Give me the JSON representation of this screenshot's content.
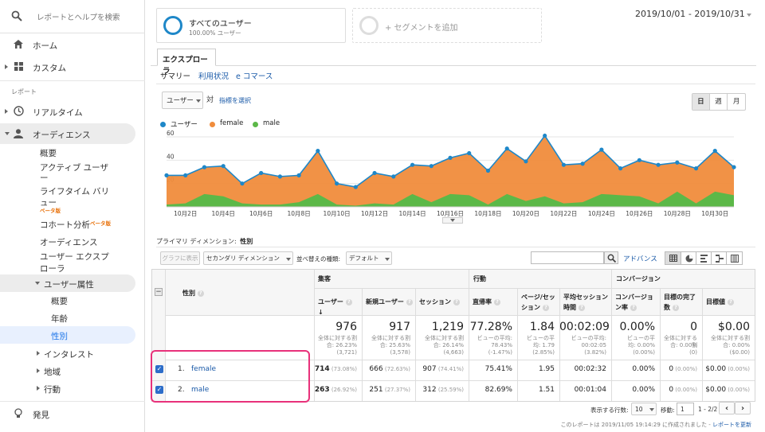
{
  "sidebar": {
    "search_placeholder": "レポートとヘルプを検索",
    "home": "ホーム",
    "custom": "カスタム",
    "reports_header": "レポート",
    "realtime": "リアルタイム",
    "audience": "オーディエンス",
    "overview": "概要",
    "active_users_1": "アクティブ ユーザ",
    "active_users_2": "ー",
    "lifetime_1": "ライフタイム バリ",
    "lifetime_2": "ュー",
    "beta": "ベータ版",
    "cohort": "コホート分析",
    "audiences": "オーディエンス",
    "user_explorer_1": "ユーザー エクスプ",
    "user_explorer_2": "ローラ",
    "demographics": "ユーザー属性",
    "demo_overview": "概要",
    "age": "年齢",
    "gender": "性別",
    "interests": "インタレスト",
    "geo": "地域",
    "behavior": "行動",
    "discover": "発見"
  },
  "segment": {
    "name": "すべてのユーザー",
    "pct": "100.00% ユーザー",
    "add": "+ セグメントを追加"
  },
  "date_range": "2019/10/01 - 2019/10/31",
  "tab_explorer": "エクスプローラ",
  "subtabs": [
    "サマリー",
    "利用状況",
    "e コマース"
  ],
  "metric_select": "ユーザー",
  "vs": "対",
  "select_metric": "指標を選択",
  "granularity": [
    "日",
    "週",
    "月"
  ],
  "legend": [
    {
      "name": "ユーザー",
      "color": "#1e87c8"
    },
    {
      "name": "female",
      "color": "#f08c3c"
    },
    {
      "name": "male",
      "color": "#5cb848"
    }
  ],
  "chart_data": {
    "type": "area",
    "x": [
      "10/1",
      "10/2",
      "10/3",
      "10/4",
      "10/5",
      "10/6",
      "10/7",
      "10/8",
      "10/9",
      "10/10",
      "10/11",
      "10/12",
      "10/13",
      "10/14",
      "10/15",
      "10/16",
      "10/17",
      "10/18",
      "10/19",
      "10/20",
      "10/21",
      "10/22",
      "10/23",
      "10/24",
      "10/25",
      "10/26",
      "10/27",
      "10/28",
      "10/29",
      "10/30",
      "10/31"
    ],
    "x_tick_labels": [
      "10月2日",
      "10月4日",
      "10月6日",
      "10月8日",
      "10月10日",
      "10月12日",
      "10月14日",
      "10月16日",
      "10月18日",
      "10月20日",
      "10月22日",
      "10月24日",
      "10月26日",
      "10月28日",
      "10月30日"
    ],
    "y_ticks": [
      "60",
      "40",
      "20"
    ],
    "ylim": [
      0,
      60
    ],
    "series": [
      {
        "name": "ユーザー",
        "values": [
          27,
          27,
          34,
          35,
          20,
          29,
          26,
          27,
          48,
          20,
          17,
          29,
          26,
          36,
          35,
          42,
          46,
          31,
          50,
          39,
          61,
          36,
          37,
          49,
          33,
          40,
          36,
          38,
          33,
          48,
          34
        ]
      },
      {
        "name": "female",
        "values": [
          27,
          27,
          34,
          35,
          20,
          29,
          26,
          27,
          48,
          20,
          17,
          29,
          26,
          36,
          35,
          42,
          46,
          31,
          50,
          39,
          61,
          36,
          37,
          49,
          33,
          40,
          36,
          38,
          33,
          48,
          34
        ]
      },
      {
        "name": "male",
        "values": [
          2,
          3,
          11,
          9,
          3,
          2,
          2,
          4,
          11,
          2,
          1,
          3,
          2,
          11,
          4,
          11,
          10,
          2,
          11,
          5,
          9,
          3,
          4,
          11,
          10,
          9,
          3,
          13,
          3,
          13,
          10
        ]
      }
    ]
  },
  "primary_dimension_label": "プライマリ ディメンション:",
  "primary_dimension_value": "性別",
  "toolbar": {
    "plot": "グラフに表示",
    "secondary": "セカンダリ ディメンション",
    "sort_label": "並べ替えの種類:",
    "sort_value": "デフォルト",
    "advanced": "アドバンス"
  },
  "table": {
    "dim_header": "性別",
    "groups": [
      "集客",
      "行動",
      "コンバージョン"
    ],
    "headers": [
      [
        "ユーザー"
      ],
      [
        "新規ユーザー"
      ],
      [
        "セッション"
      ],
      [
        "直帰率"
      ],
      [
        "ページ/セッ",
        "ション"
      ],
      [
        "平均セッション",
        "時間"
      ],
      [
        "コンバージョ",
        "ン率"
      ],
      [
        "目標の完了",
        "数"
      ],
      [
        "目標値"
      ]
    ],
    "totals": [
      {
        "big": "976",
        "small": [
          "全体に対する割",
          "合: 26.23%",
          "(3,721)"
        ]
      },
      {
        "big": "917",
        "small": [
          "全体に対する割",
          "合: 25.63%",
          "(3,578)"
        ]
      },
      {
        "big": "1,219",
        "small": [
          "全体に対する割",
          "合: 26.14%",
          "(4,663)"
        ]
      },
      {
        "big": "77.28%",
        "small": [
          "ビューの平均:",
          "78.43%",
          "(-1.47%)"
        ]
      },
      {
        "big": "1.84",
        "small": [
          "ビューの平",
          "均: 1.79",
          "(2.85%)"
        ]
      },
      {
        "big": "00:02:09",
        "small": [
          "ビューの平均:",
          "00:02:05",
          "(3.82%)"
        ]
      },
      {
        "big": "0.00%",
        "small": [
          "ビューの平",
          "均: 0.00%",
          "(0.00%)"
        ]
      },
      {
        "big": "0",
        "small": [
          "全体に対する割",
          "合: 0.00%",
          "(0)"
        ]
      },
      {
        "big": "$0.00",
        "small": [
          "全体に対する割",
          "合: 0.00%",
          "($0.00)"
        ]
      }
    ],
    "rows": [
      {
        "idx": "1.",
        "name": "female",
        "cells": [
          [
            "714",
            "(73.08%)"
          ],
          [
            "666",
            "(72.63%)"
          ],
          [
            "907",
            "(74.41%)"
          ],
          [
            "75.41%",
            ""
          ],
          [
            "1.95",
            ""
          ],
          [
            "00:02:32",
            ""
          ],
          [
            "0.00%",
            ""
          ],
          [
            "0",
            "(0.00%)"
          ],
          [
            "$0.00",
            "(0.00%)"
          ]
        ]
      },
      {
        "idx": "2.",
        "name": "male",
        "cells": [
          [
            "263",
            "(26.92%)"
          ],
          [
            "251",
            "(27.37%)"
          ],
          [
            "312",
            "(25.59%)"
          ],
          [
            "82.69%",
            ""
          ],
          [
            "1.51",
            ""
          ],
          [
            "00:01:04",
            ""
          ],
          [
            "0.00%",
            ""
          ],
          [
            "0",
            "(0.00%)"
          ],
          [
            "$0.00",
            "(0.00%)"
          ]
        ]
      }
    ]
  },
  "pager": {
    "rows_label": "表示する行数:",
    "rows_value": "10",
    "goto_label": "移動:",
    "goto_value": "1",
    "range": "1 - 2/2"
  },
  "footer": "このレポートは 2019/11/05 19:14:29 に作成されました -",
  "refresh": "レポートを更新",
  "highlight_color": "#e8317a"
}
